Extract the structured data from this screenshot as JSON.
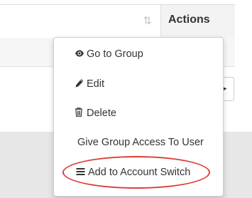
{
  "table": {
    "header": {
      "actions_label": "Actions",
      "sort_icon": "sort-arrows-icon"
    }
  },
  "dropdown": {
    "items": [
      {
        "label": "Go to Group",
        "icon": "eye-icon"
      },
      {
        "label": "Edit",
        "icon": "pencil-icon"
      },
      {
        "label": "Delete",
        "icon": "trash-icon"
      },
      {
        "label": "Give Group Access To User",
        "icon": ""
      },
      {
        "label": "Add to Account Switch",
        "icon": "bars-icon"
      }
    ]
  },
  "highlight": {
    "target": "Add to Account Switch",
    "color": "#d9403a"
  },
  "colors": {
    "header_actions_bg": "#f3f3f3",
    "footer_band": "#e7e7e7",
    "text": "#333333"
  }
}
